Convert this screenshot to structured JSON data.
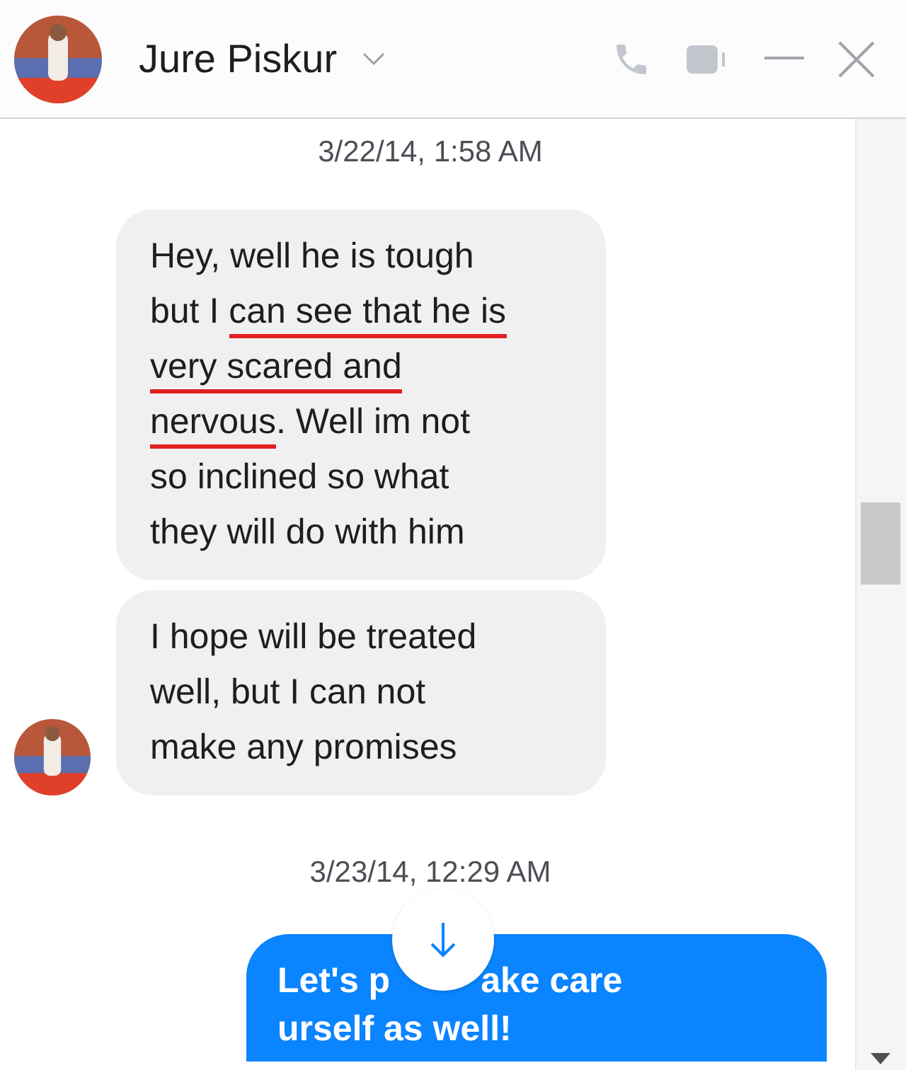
{
  "header": {
    "name": "Jure Piskur"
  },
  "messages": [
    {
      "kind": "timestamp",
      "text": "3/22/14, 1:58 AM"
    },
    {
      "kind": "received",
      "avatar": false,
      "lines": [
        [
          {
            "text": "Hey, well he is tough",
            "underlined": false
          }
        ],
        [
          {
            "text": "but I ",
            "underlined": false
          },
          {
            "text": "can see that he is",
            "underlined": true
          }
        ],
        [
          {
            "text": "very scared and",
            "underlined": true
          }
        ],
        [
          {
            "text": "nervous",
            "underlined": true
          },
          {
            "text": ". Well im not",
            "underlined": false
          }
        ],
        [
          {
            "text": "so inclined so what",
            "underlined": false
          }
        ],
        [
          {
            "text": "they will do with him",
            "underlined": false
          }
        ]
      ]
    },
    {
      "kind": "received",
      "avatar": true,
      "lines": [
        [
          {
            "text": "I hope will be treated",
            "underlined": false
          }
        ],
        [
          {
            "text": "well, but I can not",
            "underlined": false
          }
        ],
        [
          {
            "text": "make any promises",
            "underlined": false
          }
        ]
      ]
    },
    {
      "kind": "timestamp",
      "text": "3/23/14, 12:29 AM"
    },
    {
      "kind": "sent",
      "fragments": [
        "Let's p",
        "ake care",
        "urself as well!"
      ]
    }
  ]
}
